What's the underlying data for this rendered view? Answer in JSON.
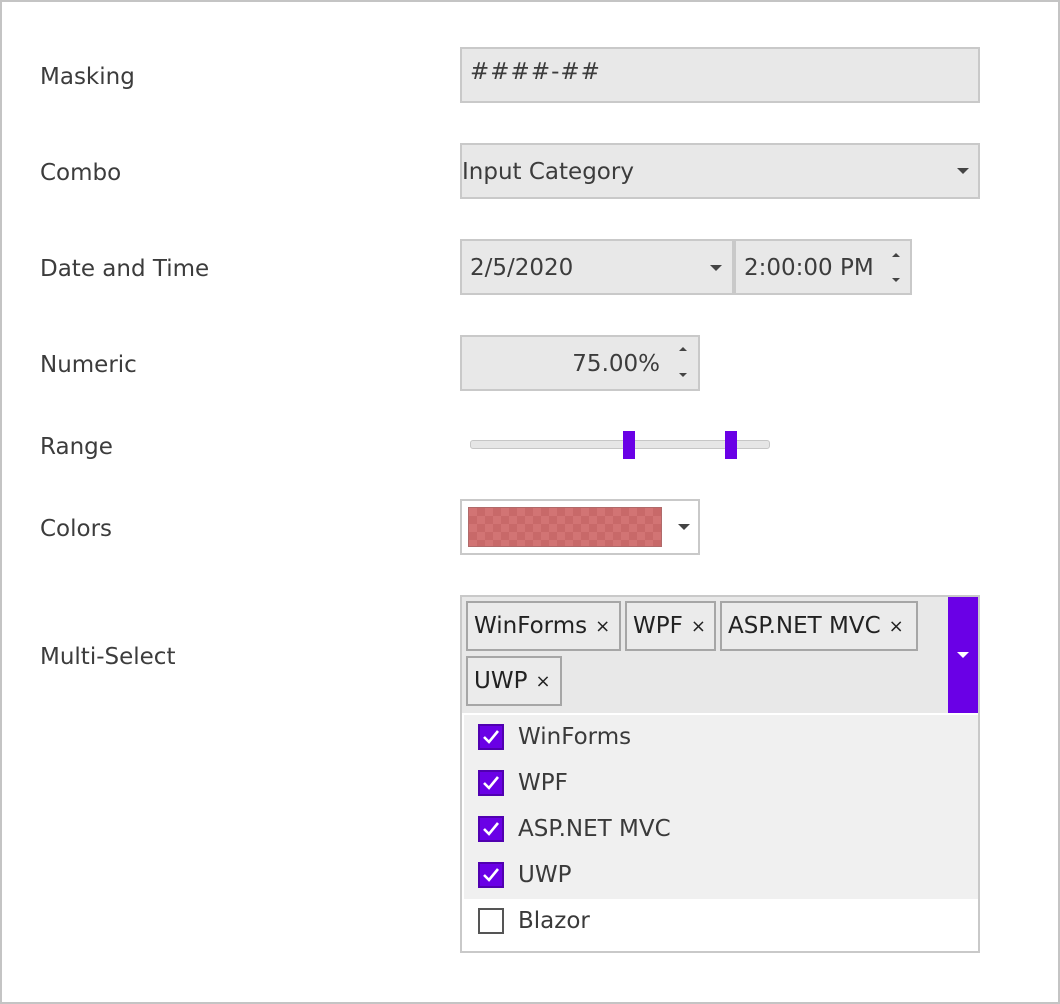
{
  "labels": {
    "masking": "Masking",
    "combo": "Combo",
    "date_time": "Date and Time",
    "numeric": "Numeric",
    "range": "Range",
    "colors": "Colors",
    "multi_select": "Multi-Select"
  },
  "masking": {
    "value": "####-##"
  },
  "combo": {
    "value": "Input Category"
  },
  "date": {
    "value": "2/5/2020"
  },
  "time": {
    "value": "2:00:00 PM"
  },
  "numeric": {
    "value": "75.00%"
  },
  "range": {
    "low_fraction": 0.53,
    "high_fraction": 0.87
  },
  "colors": {
    "selected": "#d27474"
  },
  "accent_color": "#6a00e6",
  "multi_select": {
    "tags": [
      "WinForms",
      "WPF",
      "ASP.NET MVC",
      "UWP"
    ],
    "remove_glyph": "×",
    "items": [
      {
        "label": "WinForms",
        "checked": true
      },
      {
        "label": "WPF",
        "checked": true
      },
      {
        "label": "ASP.NET MVC",
        "checked": true
      },
      {
        "label": "UWP",
        "checked": true
      },
      {
        "label": "Blazor",
        "checked": false
      }
    ]
  }
}
